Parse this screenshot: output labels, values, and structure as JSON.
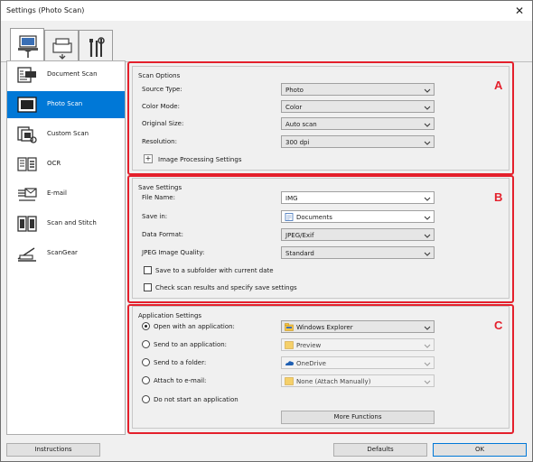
{
  "window": {
    "title": "Settings (Photo Scan)",
    "close_glyph": "✕"
  },
  "tabs": [
    {
      "icon": "scan-from-computer-icon",
      "active": true
    },
    {
      "icon": "scan-from-operation-panel-icon",
      "active": false
    },
    {
      "icon": "general-settings-icon",
      "active": false
    }
  ],
  "nav": {
    "items": [
      {
        "label": "Document Scan",
        "icon": "document-scan-icon"
      },
      {
        "label": "Photo Scan",
        "icon": "photo-scan-icon",
        "selected": true
      },
      {
        "label": "Custom Scan",
        "icon": "custom-scan-icon"
      },
      {
        "label": "OCR",
        "icon": "ocr-icon"
      },
      {
        "label": "E-mail",
        "icon": "email-icon"
      },
      {
        "label": "Scan and Stitch",
        "icon": "scan-and-stitch-icon"
      },
      {
        "label": "ScanGear",
        "icon": "scangear-icon"
      }
    ]
  },
  "scan_options": {
    "title": "Scan Options",
    "marker": "A",
    "source_type": {
      "label": "Source Type:",
      "value": "Photo"
    },
    "color_mode": {
      "label": "Color Mode:",
      "value": "Color"
    },
    "original_size": {
      "label": "Original Size:",
      "value": "Auto scan"
    },
    "resolution": {
      "label": "Resolution:",
      "value": "300 dpi"
    },
    "image_processing": {
      "label": "Image Processing Settings",
      "toggle": "+"
    }
  },
  "save_settings": {
    "title": "Save Settings",
    "marker": "B",
    "file_name": {
      "label": "File Name:",
      "value": "IMG"
    },
    "save_in": {
      "label": "Save in:",
      "value": "Documents"
    },
    "data_format": {
      "label": "Data Format:",
      "value": "JPEG/Exif"
    },
    "jpeg_quality": {
      "label": "JPEG Image Quality:",
      "value": "Standard"
    },
    "subfolder": {
      "label": "Save to a subfolder with current date",
      "checked": false
    },
    "check_results": {
      "label": "Check scan results and specify save settings",
      "checked": false
    }
  },
  "app_settings": {
    "title": "Application Settings",
    "marker": "C",
    "open_with_app": {
      "label": "Open with an application:",
      "value": "Windows Explorer",
      "checked": true
    },
    "send_to_app": {
      "label": "Send to an application:",
      "value": "Preview",
      "checked": false
    },
    "send_to_folder": {
      "label": "Send to a folder:",
      "value": "OneDrive",
      "checked": false
    },
    "attach_email": {
      "label": "Attach to e-mail:",
      "value": "None (Attach Manually)",
      "checked": false
    },
    "no_app": {
      "label": "Do not start an application",
      "checked": false
    },
    "more_functions": "More Functions"
  },
  "footer": {
    "instructions": "Instructions",
    "defaults": "Defaults",
    "ok": "OK"
  },
  "colors": {
    "highlight": "#e4202c",
    "selection": "#0078d7",
    "background": "#f0f0f0"
  }
}
